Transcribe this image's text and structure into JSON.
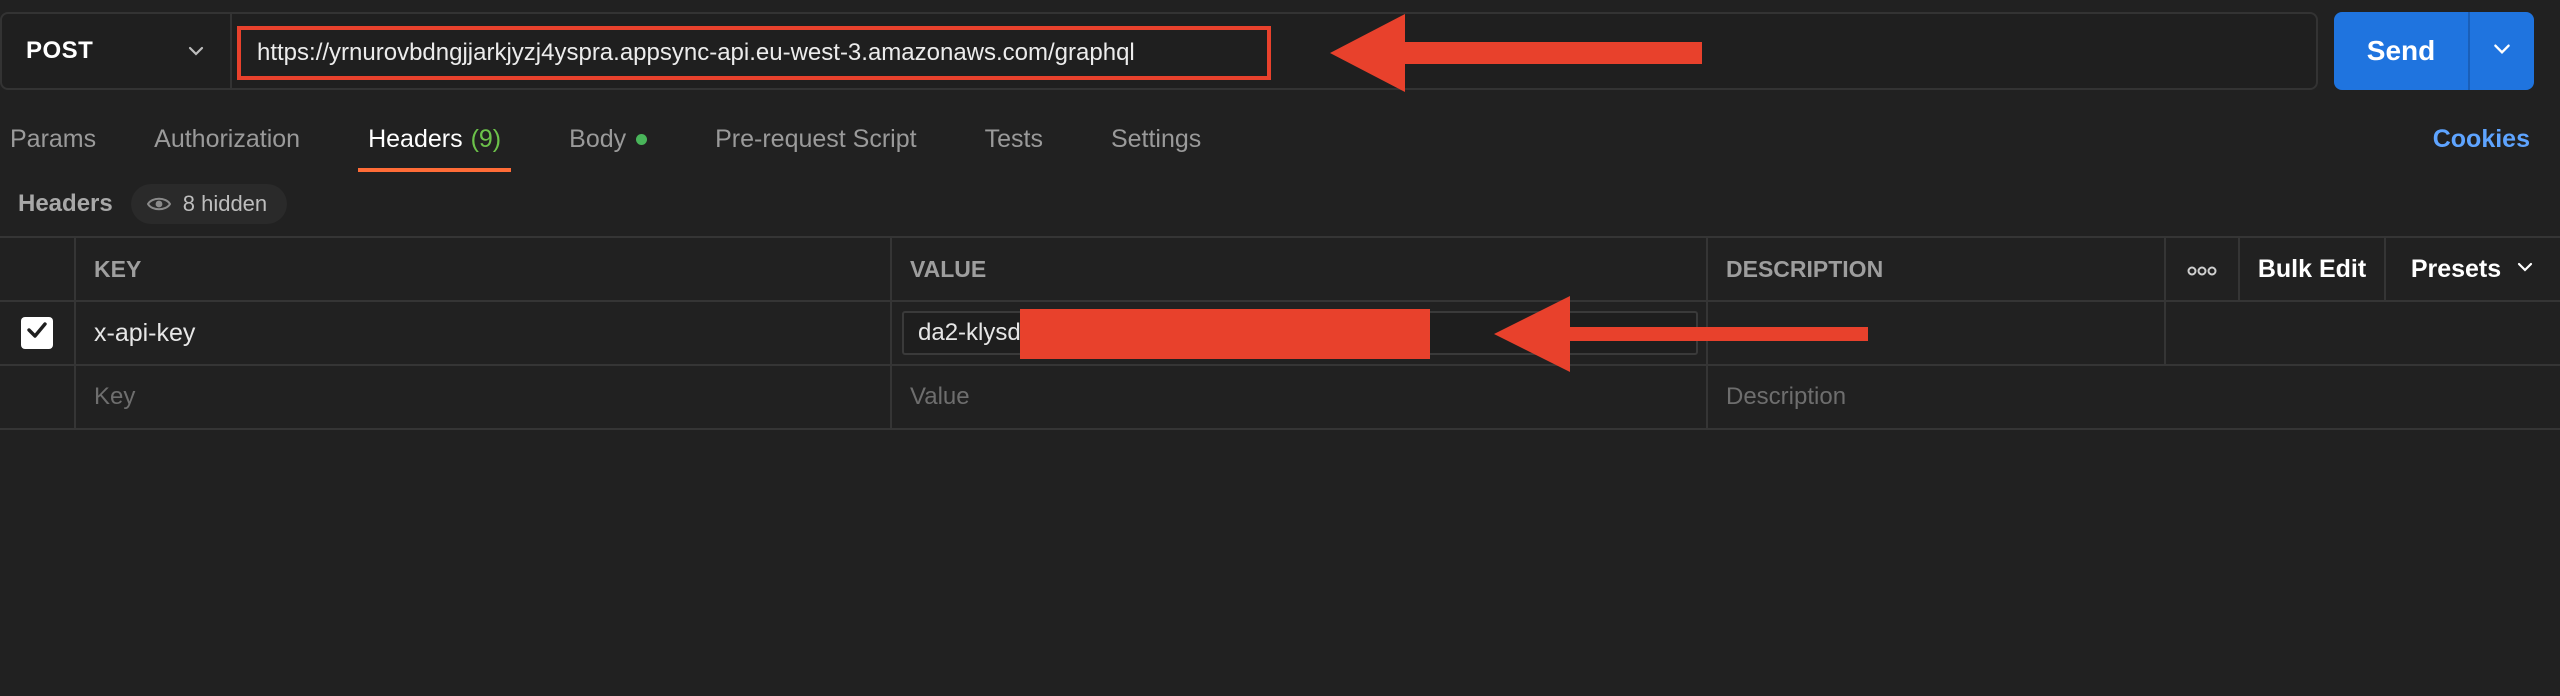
{
  "request": {
    "method": "POST",
    "url": "https://yrnurovbdngjjarkjyzj4yspra.appsync-api.eu-west-3.amazonaws.com/graphql",
    "send_label": "Send"
  },
  "tabs": [
    {
      "label": "Params"
    },
    {
      "label": "Authorization"
    },
    {
      "label": "Headers",
      "count": "(9)",
      "active": true
    },
    {
      "label": "Body",
      "has_dot": true
    },
    {
      "label": "Pre-request Script"
    },
    {
      "label": "Tests"
    },
    {
      "label": "Settings"
    }
  ],
  "cookies_label": "Cookies",
  "headers_section": {
    "title": "Headers",
    "hidden_label": "8 hidden"
  },
  "table": {
    "columns": {
      "key": "KEY",
      "value": "VALUE",
      "description": "DESCRIPTION",
      "bulk_edit": "Bulk Edit",
      "presets": "Presets"
    },
    "rows": [
      {
        "checked": true,
        "key": "x-api-key",
        "value": "da2-klysd"
      }
    ],
    "placeholders": {
      "key": "Key",
      "value": "Value",
      "description": "Description"
    }
  },
  "colors": {
    "accent_send": "#1f74df",
    "annotation_red": "#e8412c",
    "active_tab_underline": "#ff6c37",
    "link_blue": "#5ea4ff"
  },
  "icons": [
    "chevron-down-icon",
    "eye-icon",
    "more-horizontal-icon",
    "check-icon",
    "arrow-left-annotation"
  ]
}
